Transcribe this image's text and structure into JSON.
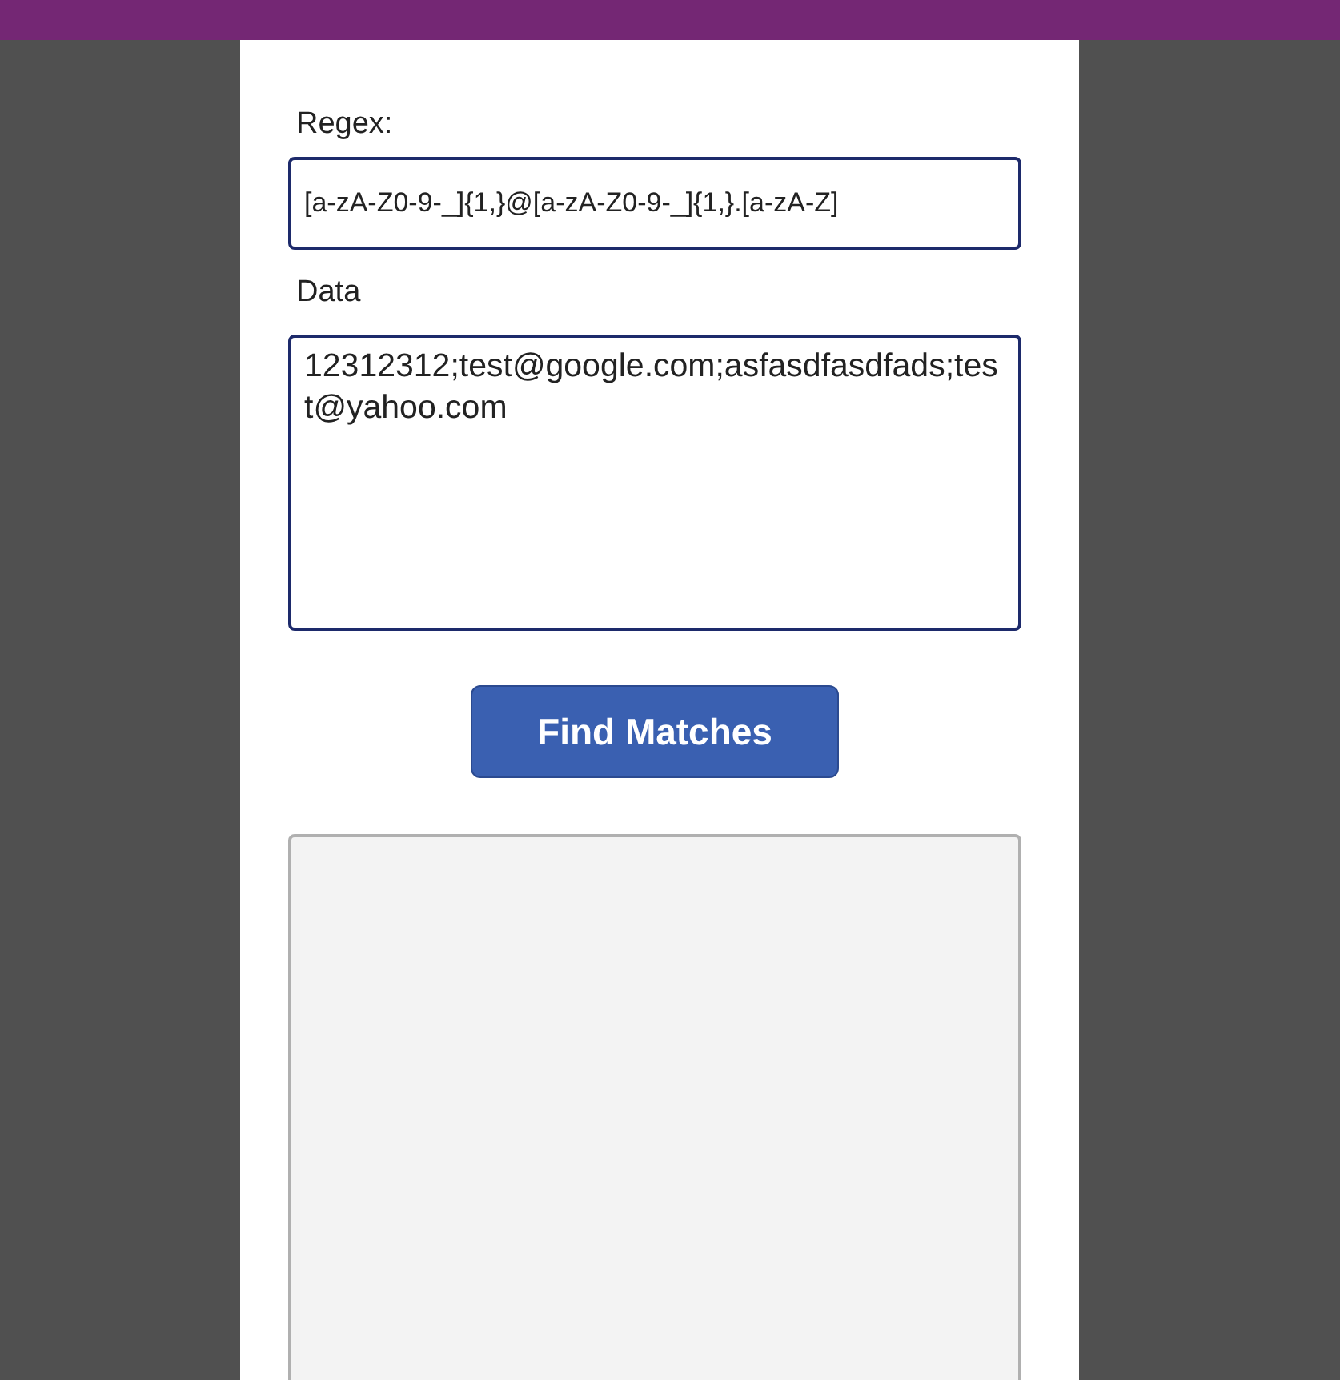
{
  "regex": {
    "label": "Regex:",
    "value": "[a-zA-Z0-9-_]{1,}@[a-zA-Z0-9-_]{1,}.[a-zA-Z]"
  },
  "data": {
    "label": "Data",
    "value": "12312312;test@google.com;asfasdfasdfads;test@yahoo.com"
  },
  "button": {
    "label": "Find Matches"
  }
}
